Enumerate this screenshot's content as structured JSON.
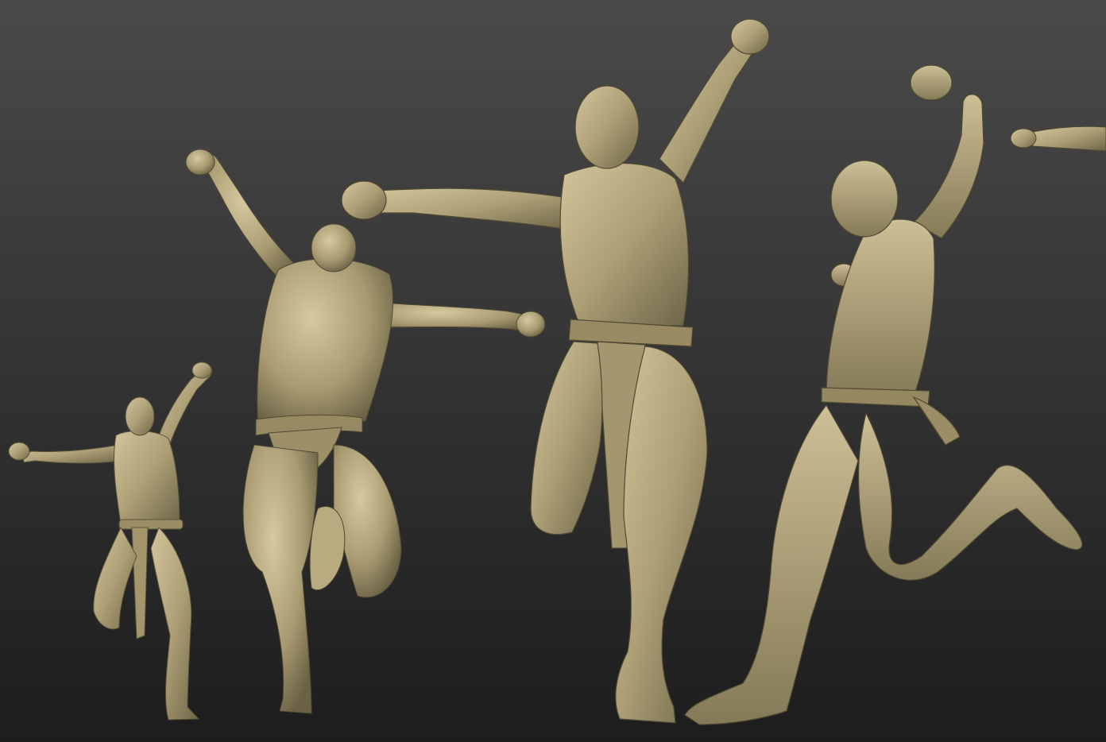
{
  "scene": {
    "subject": "sculpted-figure-turnaround",
    "figure_count": 5,
    "material": "clay",
    "colors": {
      "background_top": "#4a4a4a",
      "background_bottom": "#1d1d1d",
      "clay_light": "#c9bc93",
      "clay_mid": "#a69a72",
      "clay_dark": "#6e6548",
      "clay_shadow": "#4a4331"
    }
  }
}
